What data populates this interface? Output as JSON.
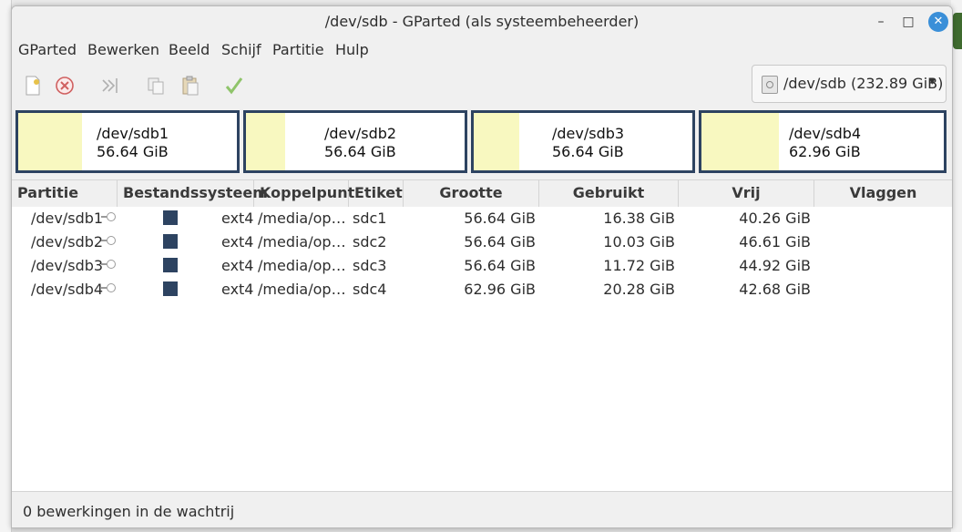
{
  "window": {
    "title": "/dev/sdb - GParted (als systeembeheerder)",
    "minimize": "–",
    "maximize": "□",
    "close": "✕"
  },
  "menubar": [
    "GParted",
    "Bewerken",
    "Beeld",
    "Schijf",
    "Partitie",
    "Hulp"
  ],
  "toolbar": {
    "icons": [
      "new-icon",
      "delete-icon",
      "resize-move-icon",
      "copy-icon",
      "paste-icon",
      "apply-icon"
    ],
    "device": "/dev/sdb (232.89 GiB)",
    "caret": "▾"
  },
  "partition_map": [
    {
      "name": "/dev/sdb1",
      "size": "56.64 GiB",
      "used_fraction": 0.29
    },
    {
      "name": "/dev/sdb2",
      "size": "56.64 GiB",
      "used_fraction": 0.18
    },
    {
      "name": "/dev/sdb3",
      "size": "56.64 GiB",
      "used_fraction": 0.21
    },
    {
      "name": "/dev/sdb4",
      "size": "62.96 GiB",
      "used_fraction": 0.32
    }
  ],
  "columns": [
    "Partitie",
    "Bestandssysteem",
    "Koppelpunt",
    "Etiket",
    "Grootte",
    "Gebruikt",
    "Vrij",
    "Vlaggen"
  ],
  "rows": [
    {
      "partition": "/dev/sdb1",
      "filesystem": "ext4",
      "mountpoint": "/media/op…",
      "label": "sdc1",
      "size": "56.64 GiB",
      "used": "16.38 GiB",
      "free": "40.26 GiB",
      "flags": ""
    },
    {
      "partition": "/dev/sdb2",
      "filesystem": "ext4",
      "mountpoint": "/media/op…",
      "label": "sdc2",
      "size": "56.64 GiB",
      "used": "10.03 GiB",
      "free": "46.61 GiB",
      "flags": ""
    },
    {
      "partition": "/dev/sdb3",
      "filesystem": "ext4",
      "mountpoint": "/media/op…",
      "label": "sdc3",
      "size": "56.64 GiB",
      "used": "11.72 GiB",
      "free": "44.92 GiB",
      "flags": ""
    },
    {
      "partition": "/dev/sdb4",
      "filesystem": "ext4",
      "mountpoint": "/media/op…",
      "label": "sdc4",
      "size": "62.96 GiB",
      "used": "20.28 GiB",
      "free": "42.68 GiB",
      "flags": ""
    }
  ],
  "colors": {
    "partition_border": "#2d4361",
    "used_fill": "#f8f8c0",
    "ext4_swatch": "#2d4361",
    "close_button": "#3a8fd8"
  },
  "status": "0 bewerkingen in de wachtrij"
}
